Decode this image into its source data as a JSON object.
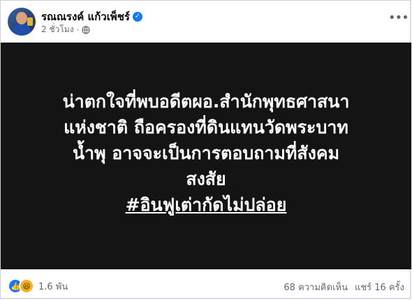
{
  "author": {
    "name": "รณณรงค์ แก้วเพ็ชร์",
    "time": "2 ชั่วโมง"
  },
  "post": {
    "lines": [
      "น่าตกใจที่พบอดีตผอ.สำนักพุทธศาสนา",
      "แห่งชาติ ถือครองที่ดินแทนวัดพระบาท",
      "น้ำพุ อาจจะเป็นการตอบถามที่สังคม",
      "สงสัย"
    ],
    "hashtag": "#อินฟูเต่ากัดไม่ปล่อย"
  },
  "footer": {
    "reactions_count": "1.6 พัน",
    "comments": "68 ความคิดเห็น",
    "shares": "แชร์ 16 ครั้ง"
  }
}
